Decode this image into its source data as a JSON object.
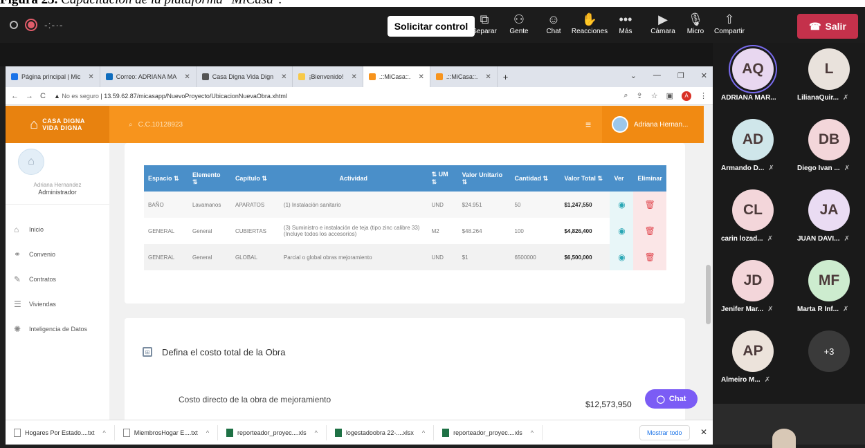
{
  "caption": {
    "label": "Figura 23.",
    "text": "Capacitación de la plataforma \"MiCasa\"."
  },
  "teams": {
    "control_button": "Solicitar control",
    "items": [
      {
        "label": "Separar",
        "icon": "pop-out-icon"
      },
      {
        "label": "Gente",
        "icon": "people-icon"
      },
      {
        "label": "Chat",
        "icon": "chat-icon"
      },
      {
        "label": "Reacciones",
        "icon": "reactions-icon"
      },
      {
        "label": "Más",
        "icon": "more-icon"
      },
      {
        "label": "Cámara",
        "icon": "camera-off-icon"
      },
      {
        "label": "Micro",
        "icon": "mic-off-icon"
      },
      {
        "label": "Compartir",
        "icon": "share-icon"
      }
    ],
    "leave_button": "Salir",
    "participants": [
      {
        "initials": "AQ",
        "name": "ADRIANA MAR...",
        "color": "#e8d7f0",
        "ring": "#7a6cf0",
        "muted": false
      },
      {
        "initials": "L",
        "name": "LilianaQuir...",
        "color": "#e9e2dc",
        "muted": true
      },
      {
        "initials": "AD",
        "name": "Armando D...",
        "color": "#cfe6ea",
        "muted": true
      },
      {
        "initials": "DB",
        "name": "Diego Ivan ...",
        "color": "#f3d6da",
        "muted": true
      },
      {
        "initials": "CL",
        "name": "carin lozad...",
        "color": "#f3d6da",
        "muted": true
      },
      {
        "initials": "JA",
        "name": "JUAN DAVI...",
        "color": "#eadcf3",
        "muted": true
      },
      {
        "initials": "JD",
        "name": "Jenifer Mar...",
        "color": "#f3d6da",
        "muted": true
      },
      {
        "initials": "MF",
        "name": "Marta R Inf...",
        "color": "#cdeccf",
        "muted": true
      },
      {
        "initials": "AP",
        "name": "Almeiro M...",
        "color": "#ece3db",
        "muted": true
      },
      {
        "initials": "+3",
        "name": "",
        "color": "#3a3a3a",
        "muted": false
      }
    ]
  },
  "browser": {
    "tabs": [
      {
        "label": "Página principal | Mic",
        "color": "#1a73e8"
      },
      {
        "label": "Correo: ADRIANA MA",
        "color": "#0f6cbd"
      },
      {
        "label": "Casa Digna Vida Dign",
        "color": "#555"
      },
      {
        "label": "¡Bienvenido!",
        "color": "#f7c948"
      },
      {
        "label": ".::MiCasa::.",
        "color": "#f7941d"
      },
      {
        "label": ".::MiCasa::.",
        "color": "#f7941d"
      }
    ],
    "security": "No es seguro",
    "url": "13.59.62.87/micasapp/NuevoProyecto/UbicacionNuevaObra.xhtml",
    "profile_initial": "A"
  },
  "app": {
    "logo_line1": "CASA DIGNA",
    "logo_line2": "VIDA DIGNA",
    "search_text": "C.C.10128923",
    "user_name": "Adriana Hernan...",
    "sidebar": {
      "name": "Adriana Hernandez",
      "role": "Administrador",
      "items": [
        {
          "label": "Inicio",
          "icon": "home-icon"
        },
        {
          "label": "Convenio",
          "icon": "link-icon"
        },
        {
          "label": "Contratos",
          "icon": "pen-icon"
        },
        {
          "label": "Viviendas",
          "icon": "list-icon"
        },
        {
          "label": "Inteligencia de Datos",
          "icon": "brain-icon"
        }
      ]
    },
    "table": {
      "headers": [
        "Espacio ⇅",
        "Elemento ⇅",
        "Capítulo ⇅",
        "Actividad",
        "⇅ UM ⇅",
        "Valor Unitario ⇅",
        "Cantidad ⇅",
        "Valor Total ⇅",
        "Ver",
        "Eliminar"
      ],
      "rows": [
        [
          "BAÑO",
          "Lavamanos",
          "APARATOS",
          "(1) Instalación sanitario",
          "UND",
          "$24.951",
          "50",
          "$1,247,550"
        ],
        [
          "GENERAL",
          "General",
          "CUBIERTAS",
          "(3) Suministro e instalación de teja (tipo zinc calibre 33) (Incluye todos los accesorios)",
          "M2",
          "$48.264",
          "100",
          "$4,826,400"
        ],
        [
          "GENERAL",
          "General",
          "GLOBAL",
          "Parcial o global obras mejoramiento",
          "UND",
          "$1",
          "6500000",
          "$6,500,000"
        ]
      ]
    },
    "total_section": {
      "title": "Defina el costo total de la Obra",
      "label": "Costo directo de la obra de mejoramiento",
      "value": "$12,573,950"
    },
    "chat_button": "Chat"
  },
  "downloads": {
    "files": [
      "Hogares Por Estado....txt",
      "MiembrosHogar E....txt",
      "reporteador_proyec....xls",
      "logestadoobra 22-....xlsx",
      "reporteador_proyec....xls"
    ],
    "show_all": "Mostrar todo"
  }
}
